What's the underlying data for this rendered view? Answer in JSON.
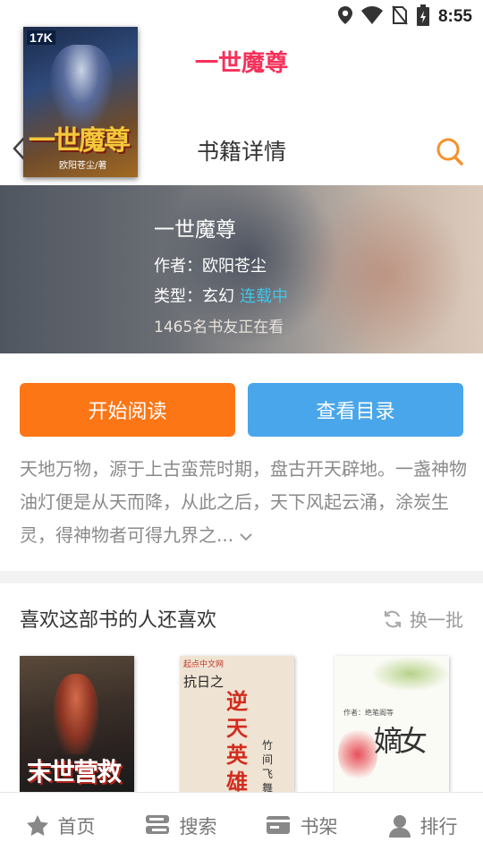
{
  "status_bar": {
    "time": "8:55"
  },
  "app_header": {
    "title": "一世魔尊"
  },
  "sub_header": {
    "home_label": "首页",
    "title": "书籍详情"
  },
  "book": {
    "title": "一世魔尊",
    "author_line": "作者：欧阳苍尘",
    "genre_label": "类型：玄幻",
    "status": "连载中",
    "readers": "1465名书友正在看",
    "cover": {
      "logo": "17K",
      "title": "一世魔尊",
      "author": "欧阳苍尘/著"
    }
  },
  "actions": {
    "read_label": "开始阅读",
    "catalog_label": "查看目录"
  },
  "description": "天地万物，源于上古蛮荒时期，盘古开天辟地。一盏神物油灯便是从天而降，从此之后，天下风起云涌，涂炭生灵，得神物者可得九界之...",
  "recommend": {
    "title": "喜欢这部书的人还喜欢",
    "refresh_label": "换一批",
    "books": [
      {
        "cover_title": "末世营救"
      },
      {
        "cover_pub": "起点中文网",
        "cover_sub": "抗日之",
        "cover_title": "逆天英雄",
        "cover_author": "竹间飞舞"
      },
      {
        "cover_author": "作者：绝笔阁等",
        "cover_title": "嫡女"
      }
    ]
  },
  "bottom_nav": [
    {
      "label": "首页",
      "icon": "star-icon"
    },
    {
      "label": "搜索",
      "icon": "search-list-icon"
    },
    {
      "label": "书架",
      "icon": "bookshelf-icon"
    },
    {
      "label": "排行",
      "icon": "person-icon"
    }
  ],
  "colors": {
    "accent_pink": "#f5315a",
    "read_button": "#fc7616",
    "catalog_button": "#4aa6ea",
    "status_cyan": "#41c5e8",
    "search_orange": "#f5922a"
  }
}
